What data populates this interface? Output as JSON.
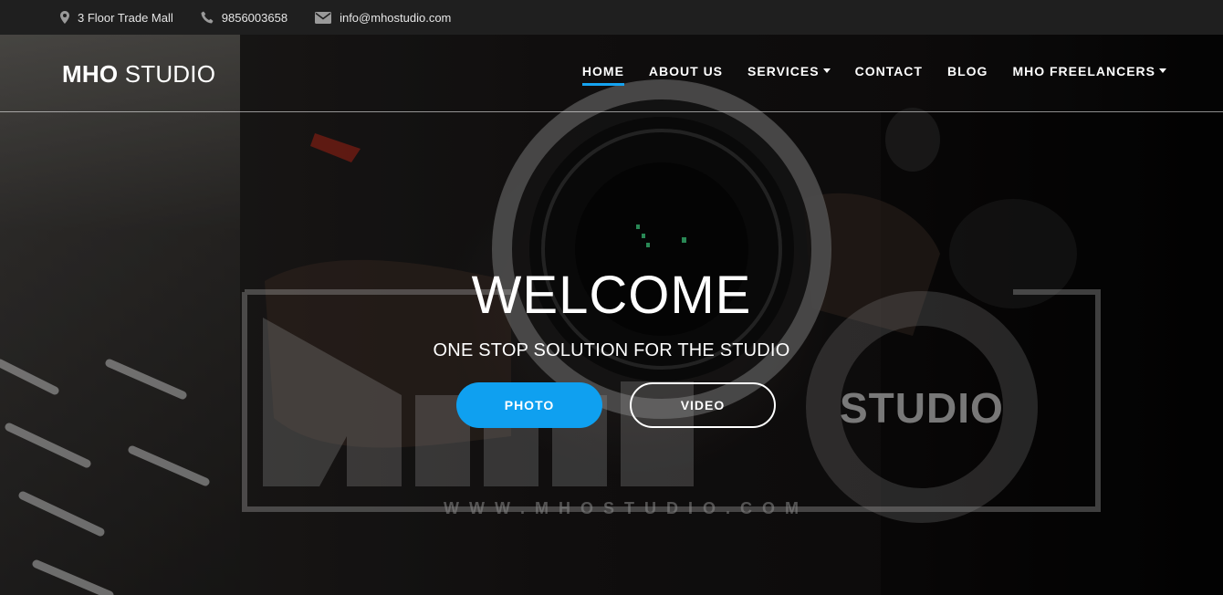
{
  "topbar": {
    "address": "3 Floor Trade Mall",
    "phone": "9856003658",
    "email": "info@mhostudio.com",
    "icons": [
      "map-pin-icon",
      "phone-icon",
      "envelope-icon"
    ]
  },
  "brand": {
    "bold": "MHO",
    "light": "STUDIO"
  },
  "nav": {
    "items": [
      {
        "label": "HOME",
        "active": true,
        "dropdown": false
      },
      {
        "label": "ABOUT US",
        "active": false,
        "dropdown": false
      },
      {
        "label": "SERVICES",
        "active": false,
        "dropdown": true
      },
      {
        "label": "CONTACT",
        "active": false,
        "dropdown": false
      },
      {
        "label": "BLOG",
        "active": false,
        "dropdown": false
      },
      {
        "label": "MHO FREELANCERS",
        "active": false,
        "dropdown": true
      }
    ]
  },
  "hero": {
    "title": "WELCOME",
    "subtitle": "ONE STOP SOLUTION FOR THE STUDIO",
    "logo_word": "STUDIO",
    "logo_url": "W W W . M H O S T U D I O . C O M",
    "photo_button": "PHOTO",
    "video_button": "VIDEO"
  },
  "colors": {
    "accent": "#0fa0f0",
    "topbar_bg": "#1f1f1f",
    "text": "#ffffff"
  }
}
